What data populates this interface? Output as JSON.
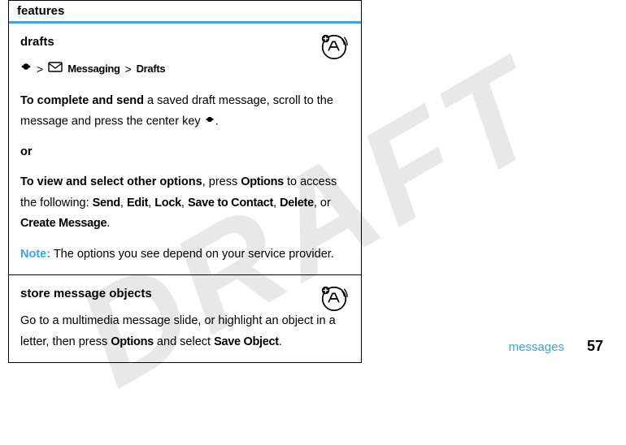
{
  "watermark": "DRAFT",
  "table": {
    "header": "features",
    "sections": [
      {
        "title": "drafts",
        "nav": {
          "menu": "Messaging",
          "sub": "Drafts"
        },
        "p1_bold": "To complete and send",
        "p1_rest": " a saved draft message, scroll to the message and press the center key ",
        "p1_end": ".",
        "or": "or",
        "p2_bold": "To view and select other options",
        "p2_mid1": ", press ",
        "p2_key1": "Options",
        "p2_mid2": " to access the following: ",
        "opts": [
          "Send",
          "Edit",
          "Lock",
          "Save to Contact",
          "Delete"
        ],
        "p2_or": ", or ",
        "p2_last": "Create Message",
        "p2_end": ".",
        "note_label": "Note:",
        "note": " The options you see depend on your service provider."
      },
      {
        "title": "store message objects",
        "body_a": "Go to a multimedia message slide, or highlight an object in a letter, then press ",
        "body_key": "Options",
        "body_b": " and select ",
        "body_key2": "Save Object",
        "body_end": "."
      }
    ]
  },
  "footer": {
    "category": "messages",
    "page": "57"
  }
}
